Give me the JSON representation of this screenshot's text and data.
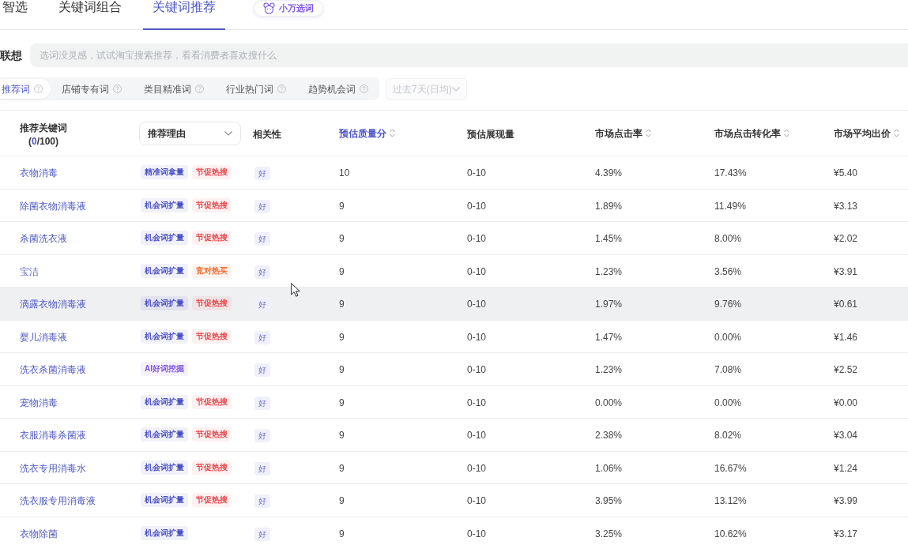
{
  "top_tabs": [
    {
      "label": "智选",
      "selected": false
    },
    {
      "label": "关键词组合",
      "selected": false
    },
    {
      "label": "关键词推荐",
      "selected": true
    }
  ],
  "assistant_button": {
    "label": "小万选词"
  },
  "search": {
    "label": "联想",
    "placeholder": "选词没灵感，试试淘宝搜索推荐，看看消费者喜欢搜什么"
  },
  "filter_tabs": [
    {
      "label": "推荐词",
      "selected": true
    },
    {
      "label": "店铺专有词",
      "selected": false
    },
    {
      "label": "类目精准词",
      "selected": false
    },
    {
      "label": "行业热门词",
      "selected": false
    },
    {
      "label": "趋势机会词",
      "selected": false
    }
  ],
  "period_dropdown": {
    "value": "过去7天(日均)",
    "disabled": true
  },
  "table": {
    "columns": [
      {
        "label": "推荐关键词",
        "kind": "counter",
        "sorted": false,
        "counter": {
          "before": "(",
          "value": "0",
          "after": "/100)"
        }
      },
      {
        "label": "推荐理由",
        "kind": "select",
        "sorted": false
      },
      {
        "label": "相关性",
        "kind": "plain",
        "sorted": false
      },
      {
        "label": "预估质量分",
        "kind": "sort",
        "sorted": true
      },
      {
        "label": "预估展现量",
        "kind": "plain",
        "sorted": false
      },
      {
        "label": "市场点击率",
        "kind": "sort",
        "sorted": false
      },
      {
        "label": "市场点击转化率",
        "kind": "sort",
        "sorted": false
      },
      {
        "label": "市场平均出价",
        "kind": "sort",
        "sorted": false
      }
    ],
    "rows": [
      {
        "keyword": "衣物消毒",
        "reasons": [
          {
            "label": "精准词拿量",
            "color": "#4b51c4"
          },
          {
            "label": "节促热搜",
            "color": "#e5474c"
          }
        ],
        "relevance": "好",
        "quality_score": "10",
        "impressions": "0-10",
        "ctr": "4.39%",
        "cvr": "17.43%",
        "avg_bid": "¥5.40",
        "hovered": false
      },
      {
        "keyword": "除菌衣物消毒液",
        "reasons": [
          {
            "label": "机会词扩量",
            "color": "#4b51c4"
          },
          {
            "label": "节促热搜",
            "color": "#e5474c"
          }
        ],
        "relevance": "好",
        "quality_score": "9",
        "impressions": "0-10",
        "ctr": "1.89%",
        "cvr": "11.49%",
        "avg_bid": "¥3.13",
        "hovered": false
      },
      {
        "keyword": "杀菌洗衣液",
        "reasons": [
          {
            "label": "机会词扩量",
            "color": "#4b51c4"
          },
          {
            "label": "节促热搜",
            "color": "#e5474c"
          }
        ],
        "relevance": "好",
        "quality_score": "9",
        "impressions": "0-10",
        "ctr": "1.45%",
        "cvr": "8.00%",
        "avg_bid": "¥2.02",
        "hovered": false
      },
      {
        "keyword": "宝洁",
        "reasons": [
          {
            "label": "机会词扩量",
            "color": "#4b51c4"
          },
          {
            "label": "竞对热买",
            "color": "#ee6a2c"
          }
        ],
        "relevance": "好",
        "quality_score": "9",
        "impressions": "0-10",
        "ctr": "1.23%",
        "cvr": "3.56%",
        "avg_bid": "¥3.91",
        "hovered": false
      },
      {
        "keyword": "滴露衣物消毒液",
        "reasons": [
          {
            "label": "机会词扩量",
            "color": "#4b51c4"
          },
          {
            "label": "节促热搜",
            "color": "#e5474c"
          }
        ],
        "relevance": "好",
        "quality_score": "9",
        "impressions": "0-10",
        "ctr": "1.97%",
        "cvr": "9.76%",
        "avg_bid": "¥0.61",
        "hovered": true
      },
      {
        "keyword": "婴儿消毒液",
        "reasons": [
          {
            "label": "机会词扩量",
            "color": "#4b51c4"
          },
          {
            "label": "节促热搜",
            "color": "#e5474c"
          }
        ],
        "relevance": "好",
        "quality_score": "9",
        "impressions": "0-10",
        "ctr": "1.47%",
        "cvr": "0.00%",
        "avg_bid": "¥1.46",
        "hovered": false
      },
      {
        "keyword": "洗衣杀菌消毒液",
        "reasons": [
          {
            "label": "AI好词挖掘",
            "color": "#7d55e2"
          }
        ],
        "relevance": "好",
        "quality_score": "9",
        "impressions": "0-10",
        "ctr": "1.23%",
        "cvr": "7.08%",
        "avg_bid": "¥2.52",
        "hovered": false
      },
      {
        "keyword": "宠物消毒",
        "reasons": [
          {
            "label": "机会词扩量",
            "color": "#4b51c4"
          },
          {
            "label": "节促热搜",
            "color": "#e5474c"
          }
        ],
        "relevance": "好",
        "quality_score": "9",
        "impressions": "0-10",
        "ctr": "0.00%",
        "cvr": "0.00%",
        "avg_bid": "¥0.00",
        "hovered": false
      },
      {
        "keyword": "衣服消毒杀菌液",
        "reasons": [
          {
            "label": "机会词扩量",
            "color": "#4b51c4"
          },
          {
            "label": "节促热搜",
            "color": "#e5474c"
          }
        ],
        "relevance": "好",
        "quality_score": "9",
        "impressions": "0-10",
        "ctr": "2.38%",
        "cvr": "8.02%",
        "avg_bid": "¥3.04",
        "hovered": false
      },
      {
        "keyword": "洗衣专用消毒水",
        "reasons": [
          {
            "label": "机会词扩量",
            "color": "#4b51c4"
          },
          {
            "label": "节促热搜",
            "color": "#e5474c"
          }
        ],
        "relevance": "好",
        "quality_score": "9",
        "impressions": "0-10",
        "ctr": "1.06%",
        "cvr": "16.67%",
        "avg_bid": "¥1.24",
        "hovered": false
      },
      {
        "keyword": "洗衣服专用消毒液",
        "reasons": [
          {
            "label": "机会词扩量",
            "color": "#4b51c4"
          },
          {
            "label": "节促热搜",
            "color": "#e5474c"
          }
        ],
        "relevance": "好",
        "quality_score": "9",
        "impressions": "0-10",
        "ctr": "3.95%",
        "cvr": "13.12%",
        "avg_bid": "¥3.99",
        "hovered": false
      },
      {
        "keyword": "衣物除菌",
        "reasons": [
          {
            "label": "机会词扩量",
            "color": "#4b51c4"
          }
        ],
        "relevance": "好",
        "quality_score": "9",
        "impressions": "0-10",
        "ctr": "3.25%",
        "cvr": "10.62%",
        "avg_bid": "¥3.17",
        "hovered": false
      }
    ]
  }
}
